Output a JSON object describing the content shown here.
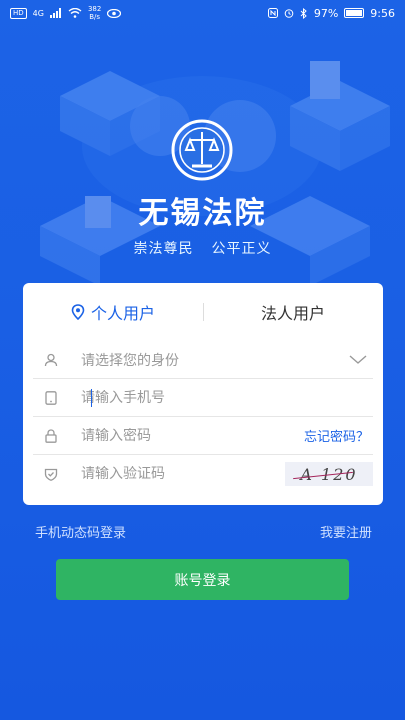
{
  "status_bar": {
    "hd_label": "HD",
    "signal_label": "4G",
    "speed_value": "382",
    "speed_unit": "B/s",
    "battery": "97%",
    "time": "9:56"
  },
  "header": {
    "app_title": "无锡法院",
    "slogan_left": "崇法尊民",
    "slogan_right": "公平正义"
  },
  "login_tabs": [
    {
      "label": "个人用户",
      "active": true
    },
    {
      "label": "法人用户",
      "active": false
    }
  ],
  "form": {
    "identity_placeholder": "请选择您的身份",
    "phone_placeholder": "请输入手机号",
    "password_placeholder": "请输入密码",
    "forgot_label": "忘记密码？",
    "captcha_placeholder": "请输入验证码",
    "captcha_text": "A 120"
  },
  "footer_links": {
    "sms_login": "手机动态码登录",
    "register": "我要注册"
  },
  "login_button": "账号登录",
  "colors": {
    "background": "#1c63e6",
    "accent": "#1c63e6",
    "button": "#2fb463"
  }
}
